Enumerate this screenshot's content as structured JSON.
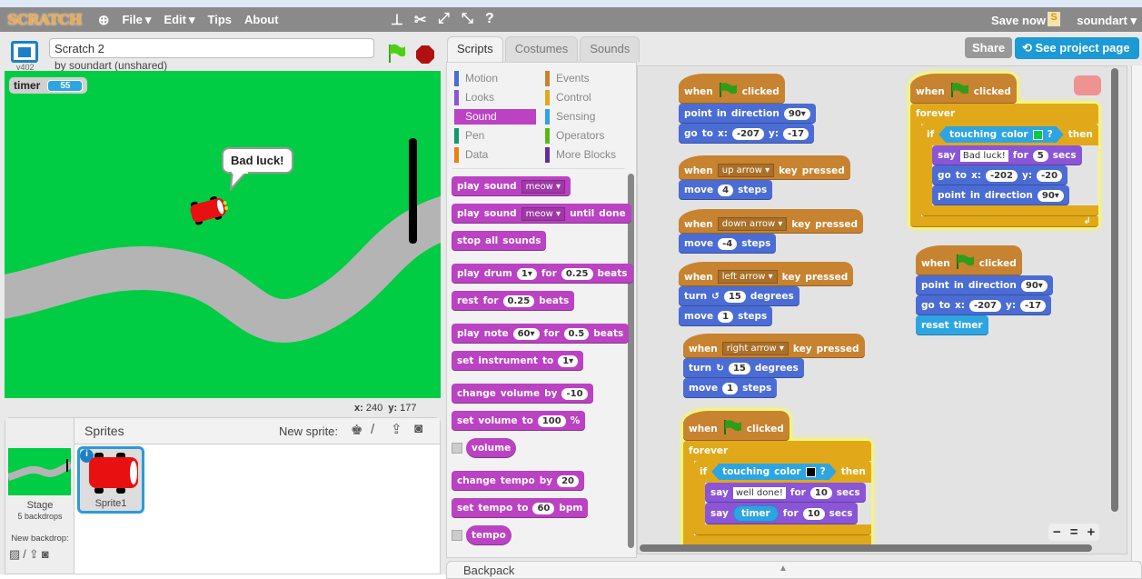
{
  "menubar": {
    "logo": "SCRATCH",
    "menus": [
      {
        "label": "File",
        "caret": "▾"
      },
      {
        "label": "Edit",
        "caret": "▾"
      },
      {
        "label": "Tips"
      },
      {
        "label": "About"
      }
    ],
    "save_now": "Save now",
    "user": "soundart ▾",
    "user_icon": "S"
  },
  "project": {
    "title": "Scratch 2",
    "byline": "by soundart (unshared)",
    "version": "v402",
    "share": "Share",
    "see_page": "See project page"
  },
  "stage": {
    "monitor": {
      "label": "timer",
      "value": "55"
    },
    "bubble": "Bad luck!",
    "background_color": "#00cc44",
    "road_color": "#b4b4b4",
    "x_label": "x:",
    "x": "240",
    "y_label": "y:",
    "y": "177"
  },
  "sprites_pane": {
    "title": "Sprites",
    "new_sprite": "New sprite:",
    "stage_label": "Stage",
    "backdrops": "5 backdrops",
    "new_backdrop": "New backdrop:",
    "sprites": [
      {
        "name": "Sprite1",
        "selected": true
      }
    ]
  },
  "tabs": [
    {
      "label": "Scripts",
      "active": true
    },
    {
      "label": "Costumes"
    },
    {
      "label": "Sounds"
    }
  ],
  "categories": [
    {
      "label": "Motion",
      "color": "#4a6cd4"
    },
    {
      "label": "Looks",
      "color": "#8a55d7"
    },
    {
      "label": "Sound",
      "color": "#bb42c3",
      "active": true
    },
    {
      "label": "Pen",
      "color": "#0e9a6c"
    },
    {
      "label": "Data",
      "color": "#ee7d16"
    },
    {
      "label": "Events",
      "color": "#c88330"
    },
    {
      "label": "Control",
      "color": "#e1a91a"
    },
    {
      "label": "Sensing",
      "color": "#2ca5e2"
    },
    {
      "label": "Operators",
      "color": "#5cb712"
    },
    {
      "label": "More Blocks",
      "color": "#632d99"
    }
  ],
  "colors": {
    "events": "#c88330",
    "control": "#e1a91a",
    "motion": "#4a6cd4",
    "looks": "#8a55d7",
    "sound": "#bb42c3",
    "sensing": "#2ca5e2"
  },
  "palette": [
    {
      "cat": "sound",
      "parts": [
        "play",
        "sound",
        {
          "dd": "meow"
        }
      ]
    },
    {
      "cat": "sound",
      "parts": [
        "play",
        "sound",
        {
          "dd": "meow"
        },
        "until",
        "done"
      ]
    },
    {
      "cat": "sound",
      "parts": [
        "stop",
        "all",
        "sounds"
      ]
    },
    {
      "cat": "sound",
      "parts": [
        "play",
        "drum",
        {
          "num": "1",
          "arrow": true
        },
        "for",
        {
          "num": "0.25"
        },
        "beats"
      ]
    },
    {
      "cat": "sound",
      "parts": [
        "rest",
        "for",
        {
          "num": "0.25"
        },
        "beats"
      ]
    },
    {
      "cat": "sound",
      "parts": [
        "play",
        "note",
        {
          "num": "60",
          "arrow": true
        },
        "for",
        {
          "num": "0.5"
        },
        "beats"
      ]
    },
    {
      "cat": "sound",
      "parts": [
        "set",
        "instrument",
        "to",
        {
          "num": "1",
          "arrow": true
        }
      ]
    },
    {
      "cat": "sound",
      "parts": [
        "change",
        "volume",
        "by",
        {
          "num": "-10"
        }
      ]
    },
    {
      "cat": "sound",
      "parts": [
        "set",
        "volume",
        "to",
        {
          "num": "100"
        },
        "%"
      ]
    },
    {
      "cat": "sound",
      "reporter": true,
      "parts": [
        "volume"
      ]
    },
    {
      "cat": "sound",
      "parts": [
        "change",
        "tempo",
        "by",
        {
          "num": "20"
        }
      ]
    },
    {
      "cat": "sound",
      "parts": [
        "set",
        "tempo",
        "to",
        {
          "num": "60"
        },
        "bpm"
      ]
    },
    {
      "cat": "sound",
      "reporter": true,
      "parts": [
        "tempo"
      ]
    }
  ],
  "scripts": [
    {
      "blocks": [
        {
          "cat": "events",
          "hat": true,
          "parts": [
            "when",
            {
              "flag": true
            },
            "clicked"
          ]
        },
        {
          "cat": "motion",
          "parts": [
            "point",
            "in",
            "direction",
            {
              "num": "90",
              "arrow": true
            }
          ]
        },
        {
          "cat": "motion",
          "parts": [
            "go",
            "to",
            "x:",
            {
              "num": "-207"
            },
            "y:",
            {
              "num": "-17"
            }
          ]
        }
      ]
    },
    {
      "blocks": [
        {
          "cat": "events",
          "hat": true,
          "parts": [
            "when",
            {
              "dd": "up arrow"
            },
            "key",
            "pressed"
          ]
        },
        {
          "cat": "motion",
          "parts": [
            "move",
            {
              "num": "4"
            },
            "steps"
          ]
        }
      ]
    },
    {
      "blocks": [
        {
          "cat": "events",
          "hat": true,
          "parts": [
            "when",
            {
              "dd": "down arrow"
            },
            "key",
            "pressed"
          ]
        },
        {
          "cat": "motion",
          "parts": [
            "move",
            {
              "num": "-4"
            },
            "steps"
          ]
        }
      ]
    },
    {
      "blocks": [
        {
          "cat": "events",
          "hat": true,
          "parts": [
            "when",
            {
              "dd": "left arrow"
            },
            "key",
            "pressed"
          ]
        },
        {
          "cat": "motion",
          "parts": [
            "turn",
            {
              "rot": "↺"
            },
            {
              "num": "15"
            },
            "degrees"
          ]
        },
        {
          "cat": "motion",
          "parts": [
            "move",
            {
              "num": "1"
            },
            "steps"
          ]
        }
      ]
    },
    {
      "blocks": [
        {
          "cat": "events",
          "hat": true,
          "parts": [
            "when",
            {
              "dd": "right arrow"
            },
            "key",
            "pressed"
          ]
        },
        {
          "cat": "motion",
          "parts": [
            "turn",
            {
              "rot": "↻"
            },
            {
              "num": "15"
            },
            "degrees"
          ]
        },
        {
          "cat": "motion",
          "parts": [
            "move",
            {
              "num": "1"
            },
            "steps"
          ]
        }
      ]
    },
    {
      "running": true,
      "blocks": [
        {
          "cat": "events",
          "hat": true,
          "parts": [
            "when",
            {
              "flag": true
            },
            "clicked"
          ]
        },
        {
          "cat": "control",
          "parts": [
            "forever"
          ],
          "children": [
            {
              "cat": "control",
              "parts": [
                "if",
                {
                  "bool": [
                    "touching",
                    "color",
                    {
                      "color": "#000000"
                    },
                    "?"
                  ]
                },
                "then"
              ],
              "children": [
                {
                  "cat": "looks",
                  "parts": [
                    "say",
                    {
                      "text": "well done!"
                    },
                    "for",
                    {
                      "num": "10"
                    },
                    "secs"
                  ]
                },
                {
                  "cat": "looks",
                  "parts": [
                    "say",
                    {
                      "rep": "timer"
                    },
                    "for",
                    {
                      "num": "10"
                    },
                    "secs"
                  ]
                }
              ]
            }
          ]
        }
      ]
    },
    {
      "running": true,
      "blocks": [
        {
          "cat": "events",
          "hat": true,
          "parts": [
            "when",
            {
              "flag": true
            },
            "clicked"
          ]
        },
        {
          "cat": "control",
          "parts": [
            "forever"
          ],
          "loop": "↲",
          "children": [
            {
              "cat": "control",
              "parts": [
                "if",
                {
                  "bool": [
                    "touching",
                    "color",
                    {
                      "color": "#00cc44"
                    },
                    "?"
                  ]
                },
                "then"
              ],
              "children": [
                {
                  "cat": "looks",
                  "parts": [
                    "say",
                    {
                      "text": "Bad luck!"
                    },
                    "for",
                    {
                      "num": "5"
                    },
                    "secs"
                  ]
                },
                {
                  "cat": "motion",
                  "parts": [
                    "go",
                    "to",
                    "x:",
                    {
                      "num": "-202"
                    },
                    "y:",
                    {
                      "num": "-20"
                    }
                  ]
                },
                {
                  "cat": "motion",
                  "parts": [
                    "point",
                    "in",
                    "direction",
                    {
                      "num": "90",
                      "arrow": true
                    }
                  ]
                }
              ]
            }
          ]
        }
      ]
    },
    {
      "blocks": [
        {
          "cat": "events",
          "hat": true,
          "parts": [
            "when",
            {
              "flag": true
            },
            "clicked"
          ]
        },
        {
          "cat": "motion",
          "parts": [
            "point",
            "in",
            "direction",
            {
              "num": "90",
              "arrow": true
            }
          ]
        },
        {
          "cat": "motion",
          "parts": [
            "go",
            "to",
            "x:",
            {
              "num": "-207"
            },
            "y:",
            {
              "num": "-17"
            }
          ]
        },
        {
          "cat": "sensing",
          "parts": [
            "reset",
            "timer"
          ]
        }
      ]
    }
  ],
  "zoom_controls": {
    "out": "−",
    "reset": "=",
    "in": "+"
  },
  "backpack": {
    "label": "Backpack",
    "arrow": "▲"
  }
}
